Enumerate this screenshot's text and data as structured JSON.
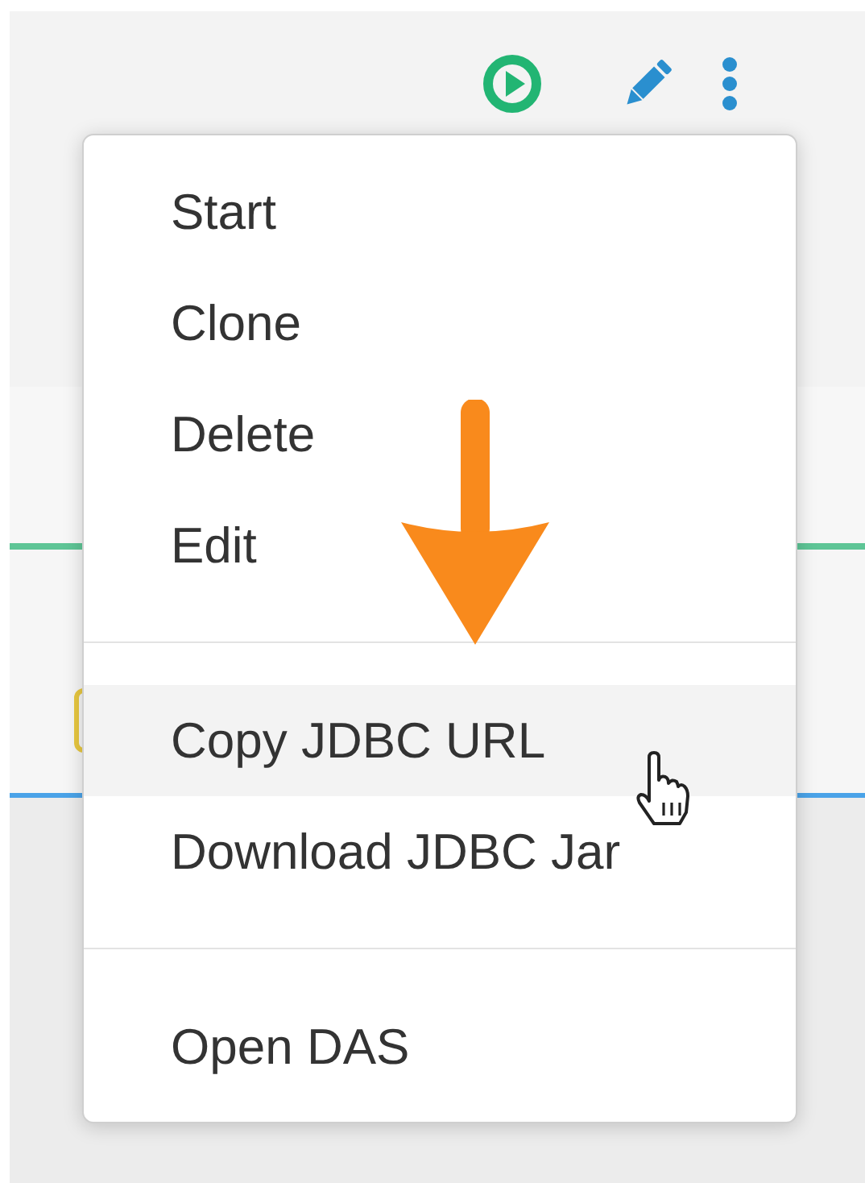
{
  "menu": {
    "groups": [
      {
        "items": [
          {
            "label": "Start",
            "selected": false
          },
          {
            "label": "Clone",
            "selected": false
          },
          {
            "label": "Delete",
            "selected": false
          },
          {
            "label": "Edit",
            "selected": false
          }
        ]
      },
      {
        "items": [
          {
            "label": "Copy JDBC URL",
            "selected": true
          },
          {
            "label": "Download JDBC Jar",
            "selected": false
          }
        ]
      },
      {
        "items": [
          {
            "label": "Open DAS",
            "selected": false
          }
        ]
      }
    ]
  }
}
